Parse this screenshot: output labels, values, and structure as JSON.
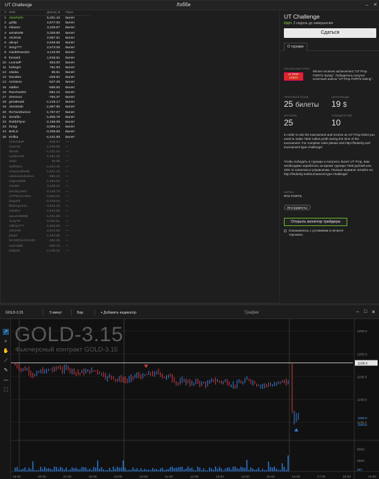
{
  "lobby": {
    "app_title": "UT Challenge",
    "window_title": "Лобби",
    "columns": {
      "rank": "#",
      "name": "Имя",
      "income": "Доход, $",
      "prize": "Приз"
    },
    "rows": [
      {
        "rank": "1",
        "name": "AlexFurlo",
        "income": "5,301.43",
        "prize": "Билет"
      },
      {
        "rank": "2",
        "name": "goltly",
        "income": "4,877.00",
        "prize": "Билет"
      },
      {
        "rank": "3",
        "name": "milaazz",
        "income": "3,329.87",
        "prize": "Билет"
      },
      {
        "rank": "4",
        "name": "wmaks86",
        "income": "3,326.80",
        "prize": "Билет"
      },
      {
        "rank": "5",
        "name": "AK2015",
        "income": "2,957.51",
        "prize": "Билет"
      },
      {
        "rank": "6",
        "name": "alexpl",
        "income": "2,646.69",
        "prize": "Билет"
      },
      {
        "rank": "7",
        "name": "Serg777",
        "income": "2,573.08",
        "prize": "Билет"
      },
      {
        "rank": "8",
        "name": "HankReardon",
        "income": "2,110.59",
        "prize": "Билет"
      },
      {
        "rank": "9",
        "name": "forward",
        "income": "1,818.61",
        "prize": "Билет"
      },
      {
        "rank": "10",
        "name": "LeonidP",
        "income": "854.00",
        "prize": "Билет"
      },
      {
        "rank": "11",
        "name": "bolinger",
        "income": "761.93",
        "prize": "Билет"
      },
      {
        "rank": "12",
        "name": "vitalsa",
        "income": "85.61",
        "prize": "Билет"
      },
      {
        "rank": "13",
        "name": "Novalex",
        "income": "-329.92",
        "prize": "Билет"
      },
      {
        "rank": "14",
        "name": "romiteso",
        "income": "-527.29",
        "prize": "Билет"
      },
      {
        "rank": "15",
        "name": "stalker",
        "income": "-568.50",
        "prize": "Билет"
      },
      {
        "rank": "16",
        "name": "Ravchan64",
        "income": "-681.12",
        "prize": "Билет"
      },
      {
        "rank": "17",
        "name": "Zemovoi",
        "income": "-794.37",
        "prize": "Билет"
      },
      {
        "rank": "18",
        "name": "greattrade",
        "income": "-1,218.17",
        "prize": "Билет"
      },
      {
        "rank": "19",
        "name": "Alextrede",
        "income": "-1,597.85",
        "prize": "Билет"
      },
      {
        "rank": "20",
        "name": "RoYanGlumov",
        "income": "-1,757.07",
        "prize": "Билет"
      },
      {
        "rank": "21",
        "name": "Serafim",
        "income": "-1,806.78",
        "prize": "Билет"
      },
      {
        "rank": "22",
        "name": "RobbFlynn",
        "income": "-2,156.09",
        "prize": "Билет"
      },
      {
        "rank": "23",
        "name": "Ihmgi",
        "income": "-3,099.14",
        "prize": "Билет"
      },
      {
        "rank": "24",
        "name": "BelLG",
        "income": "-3,258.68",
        "prize": "Билет"
      },
      {
        "rank": "25",
        "name": "Kirilka",
        "income": "-4,431.89",
        "prize": "Билет"
      },
      {
        "rank": "",
        "name": "VoevodaP",
        "income": "-625.67",
        "prize": "—"
      },
      {
        "rank": "",
        "name": "Gavrick",
        "income": "-1,049.59",
        "prize": "—"
      },
      {
        "rank": "",
        "name": "deodo",
        "income": "-1,101.24",
        "prize": "—"
      },
      {
        "rank": "",
        "name": "Lydia1316",
        "income": "-1,181.35",
        "prize": "—"
      },
      {
        "rank": "",
        "name": "antar",
        "income": "30.65",
        "prize": "—"
      },
      {
        "rank": "",
        "name": "Selfcition",
        "income": "-1,634.40",
        "prize": "—"
      },
      {
        "rank": "",
        "name": "onegoodtrade",
        "income": "-1,841.33",
        "prize": "—"
      },
      {
        "rank": "",
        "name": "valeksolodovka1",
        "income": "-984.22",
        "prize": "—"
      },
      {
        "rank": "",
        "name": "eugeny555",
        "income": "-1,452.54",
        "prize": "—"
      },
      {
        "rank": "",
        "name": "vvasko",
        "income": "3,155.22",
        "prize": "—"
      },
      {
        "rank": "",
        "name": "Dimitry1984",
        "income": "-2,218.73",
        "prize": "—"
      },
      {
        "rank": "",
        "name": "UTPSHCHKIN",
        "income": "-4,833.02",
        "prize": "—"
      },
      {
        "rank": "",
        "name": "begarle",
        "income": "-2,078.03",
        "prize": "—"
      },
      {
        "rank": "",
        "name": "illiatreg1912",
        "income": "-3,642.15",
        "prize": "—"
      },
      {
        "rank": "",
        "name": "zykaleo",
        "income": "-1,510.08",
        "prize": "—"
      },
      {
        "rank": "",
        "name": "aurum99999",
        "income": "-1,231.89",
        "prize": "—"
      },
      {
        "rank": "",
        "name": "Yuriy79",
        "income": "-3,030.51",
        "prize": "—"
      },
      {
        "rank": "",
        "name": "nikkay777",
        "income": "-1,303.96",
        "prize": "—"
      },
      {
        "rank": "",
        "name": "AlSTAR",
        "income": "-2,874.08",
        "prize": "—"
      },
      {
        "rank": "",
        "name": "jeepd",
        "income": "-1,344.85",
        "prize": "—"
      },
      {
        "rank": "",
        "name": "MAXDOLGIKH2014",
        "income": "-481.25",
        "prize": "—"
      },
      {
        "rank": "",
        "name": "Ivan1988",
        "income": "-930.76",
        "prize": "—"
      },
      {
        "rank": "",
        "name": "bolaeld",
        "income": "-2,239.42",
        "prize": "—"
      }
    ]
  },
  "info": {
    "title": "UT Challenge",
    "status_prefix": "Идёт.",
    "status_rest": " 2 недель до завершения",
    "surrender_label": "Сдаться",
    "tab_label": "О турнире",
    "prize_label": "НАЧАЛЬНЫЙ ПРИЗ",
    "prize_badge": "UT PROP",
    "prize_badge2": "FORTS",
    "achievement_text": "Winner receives achievement \"UT Prop FORTS Swing\". Победитель получит почетный значок \"UT Prop FORTS Swing\".",
    "fund_label": "ПРИЗОВОЙ ФОНД",
    "fund_value": "25",
    "fund_unit": "билеты",
    "entry_label": "ЦЕНА ВХОДА",
    "entry_value": "19",
    "entry_unit": "$",
    "players_label": "ИГРОКОВ",
    "players_value": "25",
    "winners_label": "ПОБЕДИТЕЛЕЙ",
    "winners_value": "10",
    "para_en": "In order to win the tournament and receive an UT Prop ticket you need to make 7500 rubles profit during the time of the tournament. For complete rules please visit http://finderby.net/ tournament-type-challenge/",
    "para_ru": "Чтобы победить в турнире и получить билет UT Prop, вам необходимо заработать за время турнира 7500 рублей или 15% от капитала в управлении. Полные правила читайте на http://finderby.net/tournament-type-challenge/",
    "market_label": "БИРЖА",
    "market_value": "RTS FORTS",
    "tools_label": "Инструменты",
    "monitor_label": "Открыть монитор трейдера",
    "terms_text": "Ознакомлюсь с условиями и начните торговать"
  },
  "chart": {
    "symbol": "GOLD-3.15",
    "timeframe": "5 минут",
    "bar_type": "Бар",
    "add_indicator": "+ Добавить индикатор",
    "graph_tab": "График",
    "watermark_title": "GOLD-3.15",
    "watermark_subtitle": "Фьючерсный контракт GOLD-3.15",
    "price_ticks": [
      "1205.0",
      "1200.0",
      "1195.0",
      "1190.0",
      "1185.0"
    ],
    "current_price": "1198.0",
    "price_low_a": "1186.0",
    "price_low_b": "1184.5",
    "volume_ticks": [
      "5000",
      "2500"
    ],
    "volume_current": "257",
    "time_ticks": [
      "19:00",
      "20:00",
      "21:00",
      "22:00",
      "23:00",
      "10:00",
      "11:00",
      "12:00",
      "13:00",
      "14:00",
      "15:00",
      "16:00",
      "17:00",
      "18:00",
      "19:00"
    ],
    "colors": {
      "up": "#3b7bd8",
      "down": "#d03a3a",
      "volume": "#2a73c9"
    }
  }
}
